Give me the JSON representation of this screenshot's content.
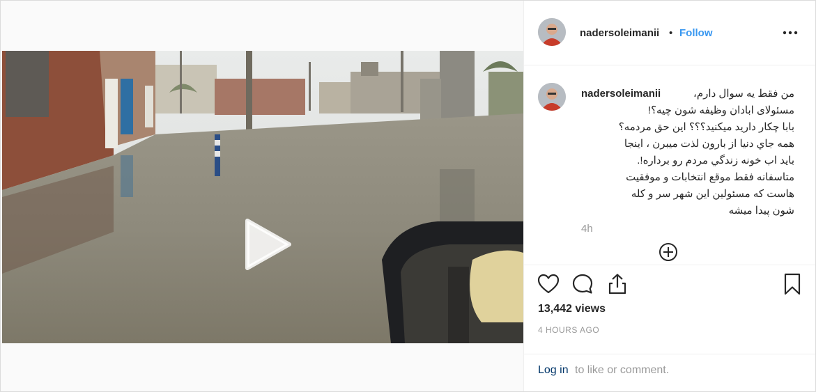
{
  "post": {
    "username": "nadersoleimanii",
    "separator": "•",
    "follow_label": "Follow",
    "more_icon": "ellipsis-icon",
    "caption": {
      "username": "nadersoleimanii",
      "text_lines": [
        "من فقط یه سوال دارم،",
        "مسئولای ابادان وظیفه شون چیه؟!",
        "بابا چکار دارید میکنید؟؟؟ این حق مردمه؟",
        "همه جاي دنيا از بارون لذت ميبرن ، اينجا",
        "بايد اب خونه زندگي مردم رو برداره!.",
        "متاسفانه فقط موقع انتخابات و موفقیت",
        "هاست که مسئولین این شهر سر و کله",
        "شون پیدا میشه"
      ],
      "age": "4h"
    },
    "views": "13,442 views",
    "timestamp": "4 HOURS AGO",
    "login_link": "Log in",
    "login_rest": "to like or comment."
  }
}
